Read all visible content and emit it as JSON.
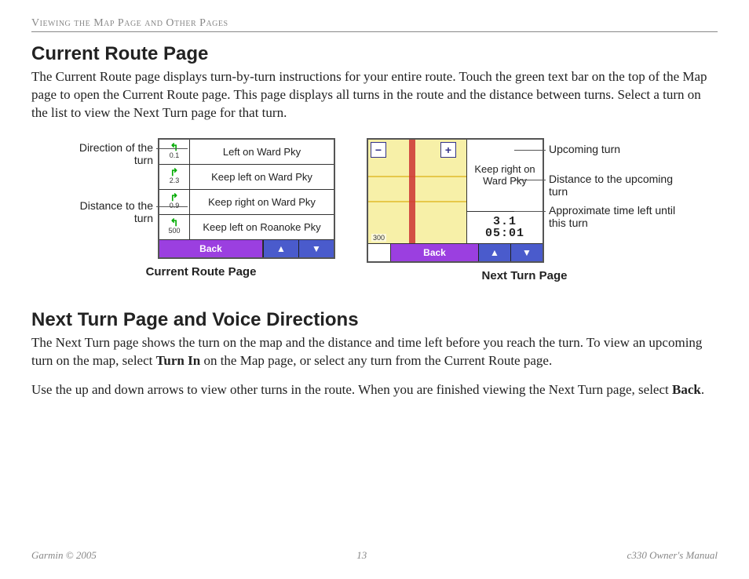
{
  "runningHead": "Viewing the Map Page and Other Pages",
  "section1": {
    "title": "Current Route Page",
    "para": "The Current Route page displays turn-by-turn instructions for your entire route. Touch the green text bar on the top of the Map page to open the Current Route page. This page displays all turns in the route and the distance between turns. Select a turn on the list to view the Next Turn page for that turn."
  },
  "fig1": {
    "calloutTop": "Direction of the turn",
    "calloutBottom": "Distance to the turn",
    "rows": [
      {
        "dist": "0.1",
        "arrow": "↰",
        "text": "Left on Ward Pky"
      },
      {
        "dist": "2.3",
        "arrow": "↱",
        "text": "Keep left on Ward Pky"
      },
      {
        "dist": "0.9",
        "arrow": "↱",
        "text": "Keep right on Ward Pky"
      },
      {
        "dist": "500",
        "arrow": "↰",
        "text": "Keep left on Roanoke Pky"
      }
    ],
    "backLabel": "Back",
    "caption": "Current Route Page"
  },
  "fig2": {
    "calloutTop": "Upcoming turn",
    "calloutMid": "Distance to the upcoming turn",
    "calloutBottom": "Approximate time left until this turn",
    "turnText": "Keep right on Ward Pky",
    "distance": "3.1",
    "time": "05:01",
    "scale": "300",
    "backLabel": "Back",
    "caption": "Next Turn Page"
  },
  "section2": {
    "title": "Next Turn Page and Voice Directions",
    "para1a": "The Next Turn page shows the turn on the map and the distance and time left before you reach the turn. To view an upcoming turn on the map, select ",
    "para1bold": "Turn In",
    "para1b": " on the Map page, or select any turn from the Current Route page.",
    "para2a": "Use the up and down arrows to view other turns in the route. When you are finished viewing the Next Turn page, select ",
    "para2bold": "Back",
    "para2b": "."
  },
  "footer": {
    "left": "Garmin © 2005",
    "center": "13",
    "right": "c330 Owner's Manual"
  }
}
